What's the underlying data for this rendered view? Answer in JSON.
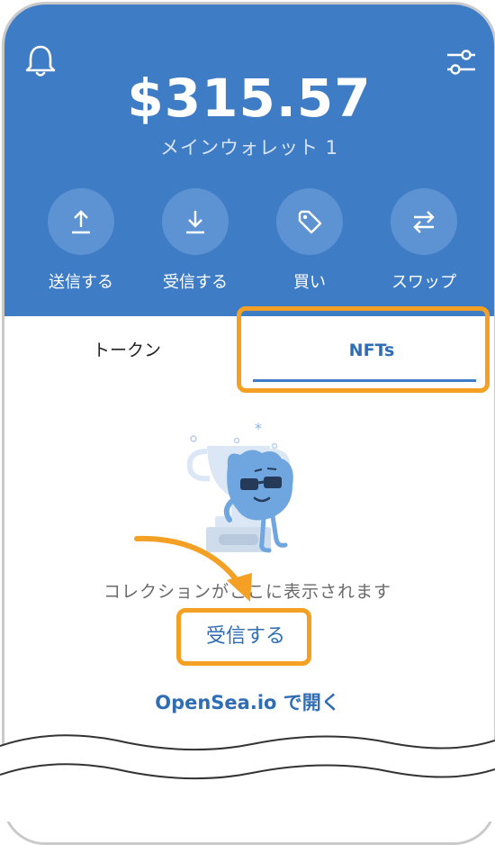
{
  "header": {
    "balance": "$315.57",
    "wallet_name": "メインウォレット 1"
  },
  "actions": [
    {
      "label": "送信する",
      "icon": "upload-icon"
    },
    {
      "label": "受信する",
      "icon": "download-icon"
    },
    {
      "label": "買い",
      "icon": "tag-icon"
    },
    {
      "label": "スワップ",
      "icon": "swap-icon"
    }
  ],
  "tabs": {
    "tokens": "トークン",
    "nfts": "NFTs",
    "active": "nfts"
  },
  "empty_state": {
    "message": "コレクションがここに表示されます",
    "receive_label": "受信する",
    "opensea_label": "OpenSea.io で開く"
  },
  "colors": {
    "header": "#3f7cc6",
    "accent": "#2f6db5",
    "highlight": "#f3a024"
  }
}
